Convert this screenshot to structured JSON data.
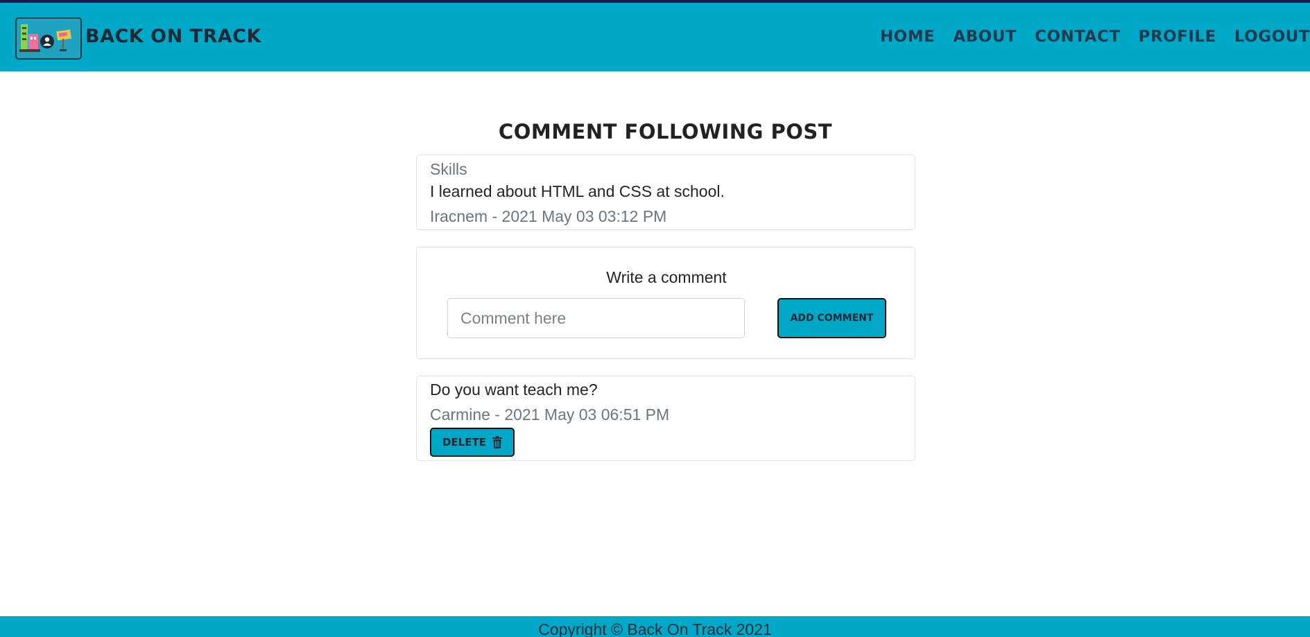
{
  "navbar": {
    "brand": "Back On Track",
    "links": [
      {
        "label": "Home"
      },
      {
        "label": "About"
      },
      {
        "label": "Contact"
      },
      {
        "label": "Profile"
      },
      {
        "label": "Logout"
      }
    ]
  },
  "main": {
    "page_title": "Comment following post",
    "post": {
      "category": "Skills",
      "text": "I learned about HTML and CSS at school.",
      "meta": "Iracnem - 2021 May 03 03:12 PM"
    },
    "comment_form": {
      "label": "Write a comment",
      "input_placeholder": "Comment here",
      "input_value": "",
      "submit_label": "Add comment"
    },
    "comments": [
      {
        "text": "Do you want teach me?",
        "meta": "Carmine - 2021 May 03 06:51 PM",
        "delete_label": "Delete",
        "delete_icon": "trash-icon"
      }
    ]
  },
  "footer": {
    "copyright": "Copyright © Back On Track 2021"
  },
  "colors": {
    "accent": "#00a8c8",
    "top_strip": "#1a1a4e",
    "text_dark": "#212529",
    "text_muted": "#6c757d"
  }
}
